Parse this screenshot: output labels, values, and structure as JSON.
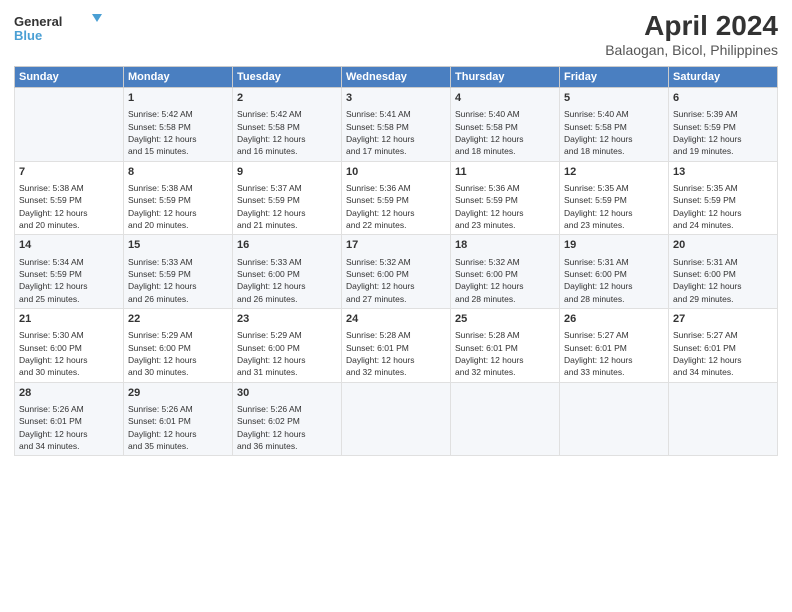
{
  "header": {
    "logo_line1": "General",
    "logo_line2": "Blue",
    "title": "April 2024",
    "subtitle": "Balaogan, Bicol, Philippines"
  },
  "columns": [
    "Sunday",
    "Monday",
    "Tuesday",
    "Wednesday",
    "Thursday",
    "Friday",
    "Saturday"
  ],
  "weeks": [
    {
      "days": [
        {
          "num": "",
          "info": ""
        },
        {
          "num": "1",
          "info": "Sunrise: 5:42 AM\nSunset: 5:58 PM\nDaylight: 12 hours\nand 15 minutes."
        },
        {
          "num": "2",
          "info": "Sunrise: 5:42 AM\nSunset: 5:58 PM\nDaylight: 12 hours\nand 16 minutes."
        },
        {
          "num": "3",
          "info": "Sunrise: 5:41 AM\nSunset: 5:58 PM\nDaylight: 12 hours\nand 17 minutes."
        },
        {
          "num": "4",
          "info": "Sunrise: 5:40 AM\nSunset: 5:58 PM\nDaylight: 12 hours\nand 18 minutes."
        },
        {
          "num": "5",
          "info": "Sunrise: 5:40 AM\nSunset: 5:58 PM\nDaylight: 12 hours\nand 18 minutes."
        },
        {
          "num": "6",
          "info": "Sunrise: 5:39 AM\nSunset: 5:59 PM\nDaylight: 12 hours\nand 19 minutes."
        }
      ]
    },
    {
      "days": [
        {
          "num": "7",
          "info": "Sunrise: 5:38 AM\nSunset: 5:59 PM\nDaylight: 12 hours\nand 20 minutes."
        },
        {
          "num": "8",
          "info": "Sunrise: 5:38 AM\nSunset: 5:59 PM\nDaylight: 12 hours\nand 20 minutes."
        },
        {
          "num": "9",
          "info": "Sunrise: 5:37 AM\nSunset: 5:59 PM\nDaylight: 12 hours\nand 21 minutes."
        },
        {
          "num": "10",
          "info": "Sunrise: 5:36 AM\nSunset: 5:59 PM\nDaylight: 12 hours\nand 22 minutes."
        },
        {
          "num": "11",
          "info": "Sunrise: 5:36 AM\nSunset: 5:59 PM\nDaylight: 12 hours\nand 23 minutes."
        },
        {
          "num": "12",
          "info": "Sunrise: 5:35 AM\nSunset: 5:59 PM\nDaylight: 12 hours\nand 23 minutes."
        },
        {
          "num": "13",
          "info": "Sunrise: 5:35 AM\nSunset: 5:59 PM\nDaylight: 12 hours\nand 24 minutes."
        }
      ]
    },
    {
      "days": [
        {
          "num": "14",
          "info": "Sunrise: 5:34 AM\nSunset: 5:59 PM\nDaylight: 12 hours\nand 25 minutes."
        },
        {
          "num": "15",
          "info": "Sunrise: 5:33 AM\nSunset: 5:59 PM\nDaylight: 12 hours\nand 26 minutes."
        },
        {
          "num": "16",
          "info": "Sunrise: 5:33 AM\nSunset: 6:00 PM\nDaylight: 12 hours\nand 26 minutes."
        },
        {
          "num": "17",
          "info": "Sunrise: 5:32 AM\nSunset: 6:00 PM\nDaylight: 12 hours\nand 27 minutes."
        },
        {
          "num": "18",
          "info": "Sunrise: 5:32 AM\nSunset: 6:00 PM\nDaylight: 12 hours\nand 28 minutes."
        },
        {
          "num": "19",
          "info": "Sunrise: 5:31 AM\nSunset: 6:00 PM\nDaylight: 12 hours\nand 28 minutes."
        },
        {
          "num": "20",
          "info": "Sunrise: 5:31 AM\nSunset: 6:00 PM\nDaylight: 12 hours\nand 29 minutes."
        }
      ]
    },
    {
      "days": [
        {
          "num": "21",
          "info": "Sunrise: 5:30 AM\nSunset: 6:00 PM\nDaylight: 12 hours\nand 30 minutes."
        },
        {
          "num": "22",
          "info": "Sunrise: 5:29 AM\nSunset: 6:00 PM\nDaylight: 12 hours\nand 30 minutes."
        },
        {
          "num": "23",
          "info": "Sunrise: 5:29 AM\nSunset: 6:00 PM\nDaylight: 12 hours\nand 31 minutes."
        },
        {
          "num": "24",
          "info": "Sunrise: 5:28 AM\nSunset: 6:01 PM\nDaylight: 12 hours\nand 32 minutes."
        },
        {
          "num": "25",
          "info": "Sunrise: 5:28 AM\nSunset: 6:01 PM\nDaylight: 12 hours\nand 32 minutes."
        },
        {
          "num": "26",
          "info": "Sunrise: 5:27 AM\nSunset: 6:01 PM\nDaylight: 12 hours\nand 33 minutes."
        },
        {
          "num": "27",
          "info": "Sunrise: 5:27 AM\nSunset: 6:01 PM\nDaylight: 12 hours\nand 34 minutes."
        }
      ]
    },
    {
      "days": [
        {
          "num": "28",
          "info": "Sunrise: 5:26 AM\nSunset: 6:01 PM\nDaylight: 12 hours\nand 34 minutes."
        },
        {
          "num": "29",
          "info": "Sunrise: 5:26 AM\nSunset: 6:01 PM\nDaylight: 12 hours\nand 35 minutes."
        },
        {
          "num": "30",
          "info": "Sunrise: 5:26 AM\nSunset: 6:02 PM\nDaylight: 12 hours\nand 36 minutes."
        },
        {
          "num": "",
          "info": ""
        },
        {
          "num": "",
          "info": ""
        },
        {
          "num": "",
          "info": ""
        },
        {
          "num": "",
          "info": ""
        }
      ]
    }
  ]
}
